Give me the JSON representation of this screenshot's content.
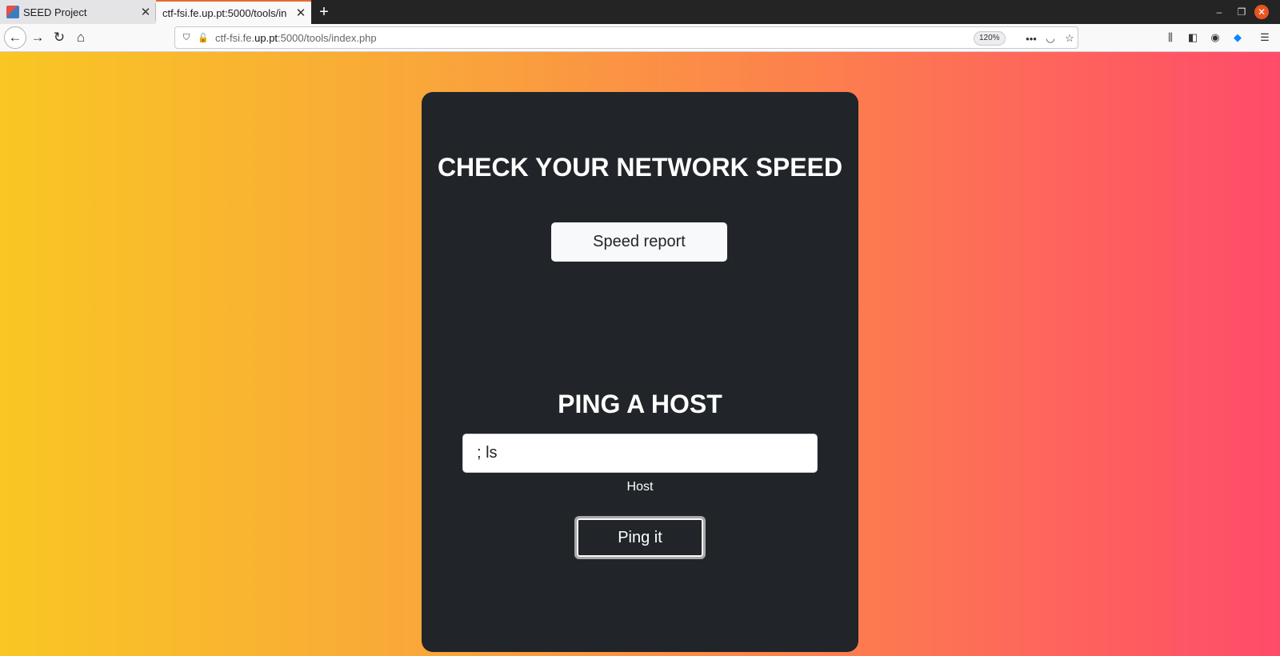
{
  "browser": {
    "tabs": [
      {
        "title": "SEED Project",
        "active": false
      },
      {
        "title": "ctf-fsi.fe.up.pt:5000/tools/in",
        "active": true
      }
    ],
    "url": {
      "prefix": "ctf-fsi.fe.",
      "domain": "up.pt",
      "suffix": ":5000/tools/index.php"
    },
    "zoom": "120%",
    "icons": {
      "back": "back-arrow-icon",
      "forward": "forward-arrow-icon",
      "reload": "reload-icon",
      "home": "home-icon",
      "shield": "shield-icon",
      "insecure": "insecure-lock-icon",
      "more": "more-actions-icon",
      "pocket": "pocket-icon",
      "bookmark": "bookmark-star-icon",
      "library": "library-icon",
      "sidebar": "sidebar-icon",
      "account": "account-icon",
      "extension": "extension-icon",
      "menu": "hamburger-menu-icon"
    }
  },
  "page": {
    "speed_heading": "CHECK YOUR NETWORK SPEED",
    "speed_button": "Speed report",
    "ping_heading": "PING A HOST",
    "host_input_value": "; ls",
    "host_label": "Host",
    "ping_button": "Ping it"
  },
  "colors": {
    "card_background": "#212529",
    "gradient_start": "#f9c623",
    "gradient_end": "#fe4b6a"
  }
}
